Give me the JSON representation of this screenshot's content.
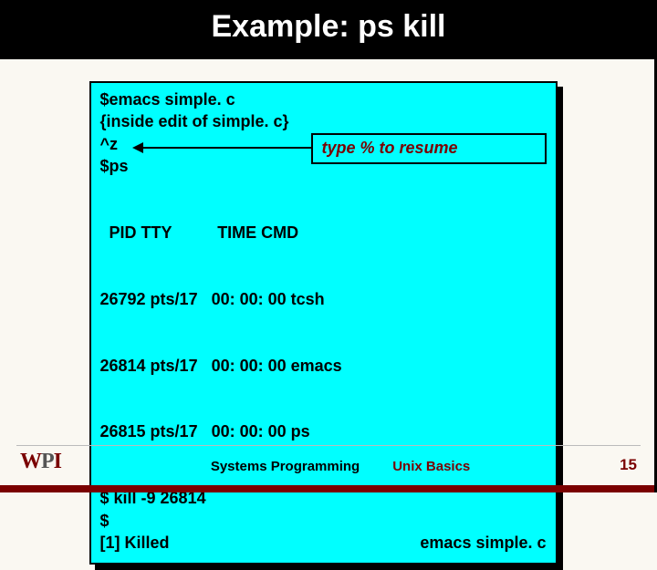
{
  "title": "Example: ps kill",
  "terminal": {
    "lines_before_ps": [
      "$emacs simple. c",
      "{inside edit of simple. c}",
      "^z",
      "$ps"
    ],
    "ps_header": "  PID TTY          TIME CMD",
    "ps_rows": [
      "26792 pts/17   00: 00: 00 tcsh",
      "26814 pts/17   00: 00: 00 emacs",
      "26815 pts/17   00: 00: 00 ps"
    ],
    "lines_after_ps": [
      "$ kill -9 26814",
      "$"
    ],
    "killed_left": "[1]    Killed",
    "killed_right": "emacs simple. c"
  },
  "annotation": "type % to resume",
  "footer": {
    "course": "Systems Programming",
    "topic": "Unix Basics",
    "page": "15",
    "logo_w": "W",
    "logo_p": "P",
    "logo_i": "I"
  }
}
